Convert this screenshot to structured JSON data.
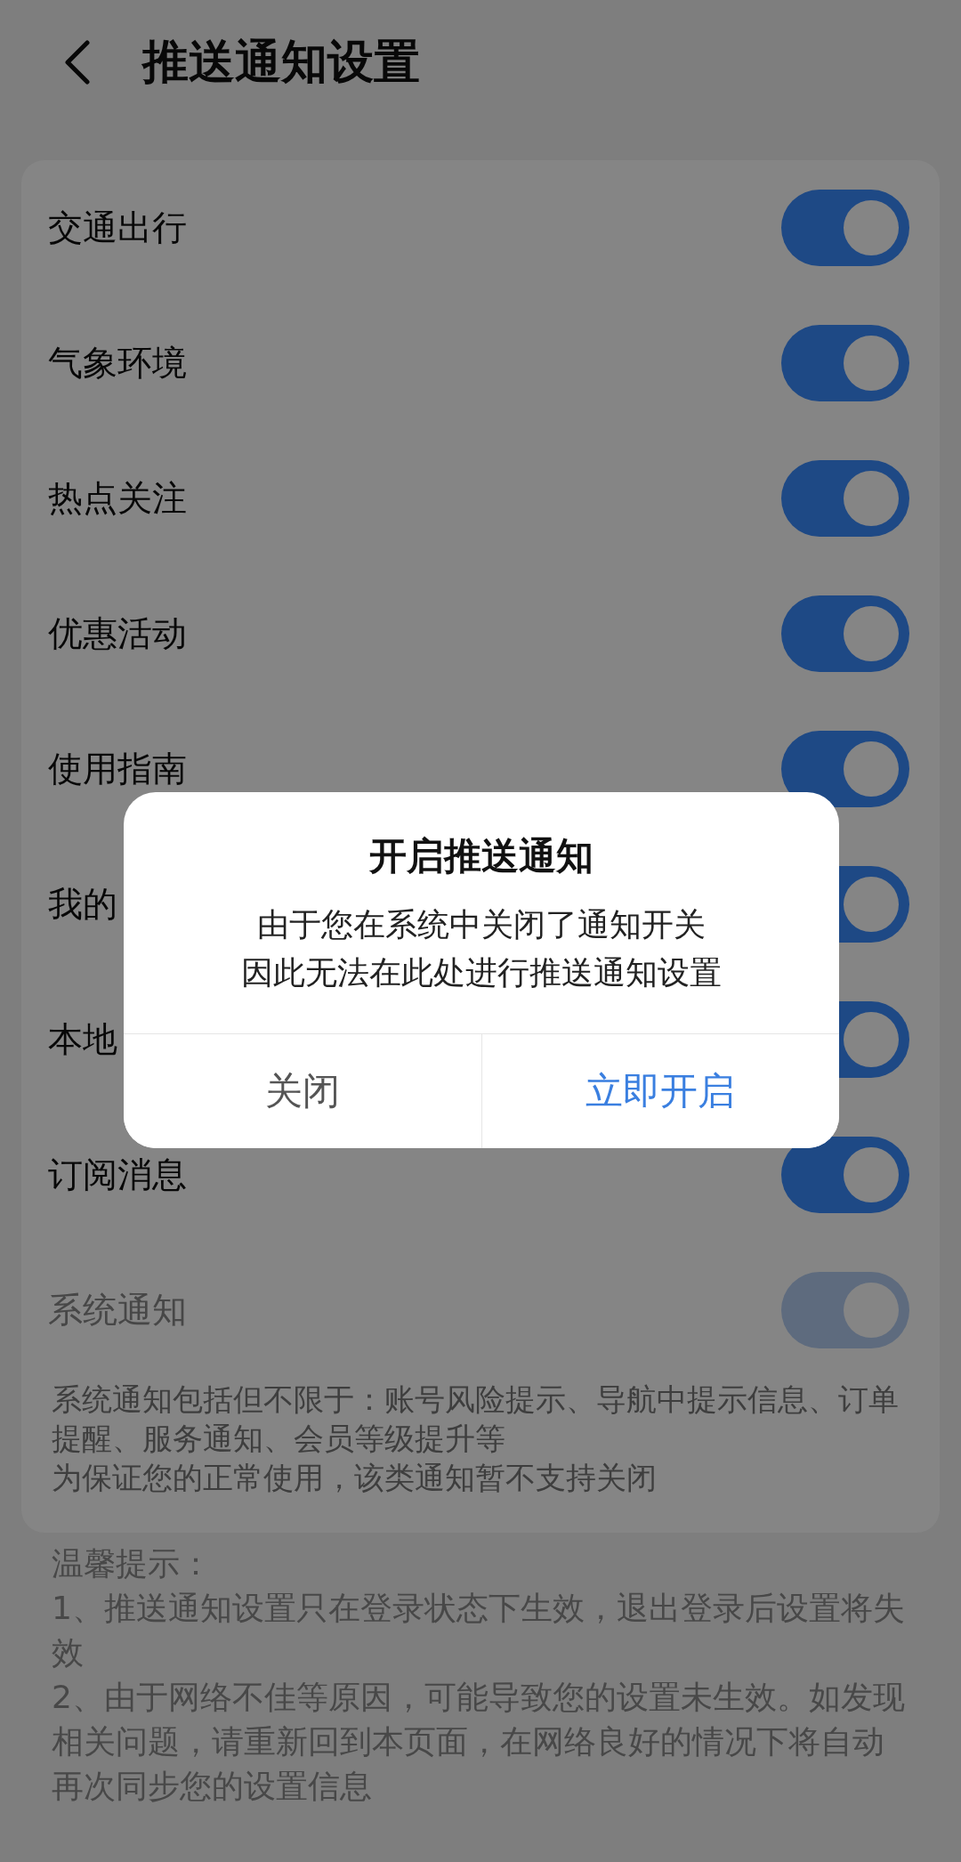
{
  "header": {
    "title": "推送通知设置"
  },
  "settings": [
    {
      "label": "交通出行",
      "on": true,
      "disabled": false
    },
    {
      "label": "气象环境",
      "on": true,
      "disabled": false
    },
    {
      "label": "热点关注",
      "on": true,
      "disabled": false
    },
    {
      "label": "优惠活动",
      "on": true,
      "disabled": false
    },
    {
      "label": "使用指南",
      "on": true,
      "disabled": false
    },
    {
      "label": "我的",
      "on": true,
      "disabled": false
    },
    {
      "label": "本地",
      "on": true,
      "disabled": false
    },
    {
      "label": "订阅消息",
      "on": true,
      "disabled": false
    },
    {
      "label": "系统通知",
      "on": true,
      "disabled": true
    }
  ],
  "system_note": [
    "系统通知包括但不限于：账号风险提示、导航中提示信息、订单提醒、服务通知、会员等级提升等",
    "为保证您的正常使用，该类通知暂不支持关闭"
  ],
  "tips": {
    "title": "温馨提示：",
    "items": [
      "1、推送通知设置只在登录状态下生效，退出登录后设置将失效",
      "2、由于网络不佳等原因，可能导致您的设置未生效。如发现相关问题，请重新回到本页面，在网络良好的情况下将自动再次同步您的设置信息"
    ]
  },
  "dialog": {
    "title": "开启推送通知",
    "message": [
      "由于您在系统中关闭了通知开关",
      "因此无法在此处进行推送通知设置"
    ],
    "buttons": [
      {
        "label": "关闭",
        "kind": "secondary"
      },
      {
        "label": "立即开启",
        "kind": "primary"
      }
    ]
  }
}
